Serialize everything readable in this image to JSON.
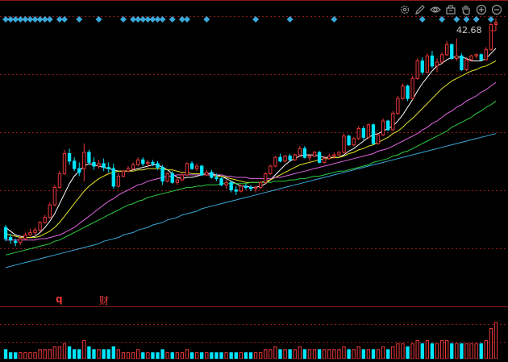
{
  "colors": {
    "background": "#000000",
    "grid": "#8b1a1a",
    "up": "#e8383a",
    "down": "#00e5ff",
    "ma5": "#ffffff",
    "ma10": "#e6e62a",
    "ma20": "#e066e0",
    "ma30": "#2ecc40",
    "ma60": "#3aa7d8",
    "event_diamond": "#3aa7d8",
    "price_label": "#d0d0d0",
    "marker_text": "#e8383a",
    "toolbar_icon": "#9a9a9a"
  },
  "toolbar": {
    "icons": [
      "settings-icon",
      "draw-pen-icon",
      "eye-icon",
      "basket-icon",
      "hand-icon",
      "circle-plus-icon",
      "circle-minus-icon"
    ]
  },
  "price": {
    "last_label": "42.68"
  },
  "markers": {
    "q_label": "q",
    "cai_label": "财"
  },
  "chart_data": {
    "type": "candlestick",
    "title": "",
    "xlabel": "",
    "ylabel": "",
    "ylim": [
      20.0,
      43.5
    ],
    "grid": true,
    "candles": [
      [
        26.3,
        26.5,
        25.2,
        25.4
      ],
      [
        25.5,
        25.8,
        25.0,
        25.3
      ],
      [
        25.2,
        25.4,
        24.8,
        25.1
      ],
      [
        25.1,
        25.6,
        24.9,
        25.4
      ],
      [
        25.4,
        25.9,
        25.3,
        25.7
      ],
      [
        25.7,
        26.2,
        25.6,
        25.9
      ],
      [
        25.9,
        26.3,
        25.7,
        26.1
      ],
      [
        26.1,
        26.8,
        26.0,
        26.7
      ],
      [
        26.7,
        27.3,
        26.6,
        27.1
      ],
      [
        27.1,
        28.3,
        27.0,
        28.1
      ],
      [
        28.1,
        29.7,
        28.0,
        29.5
      ],
      [
        29.5,
        30.8,
        29.4,
        30.6
      ],
      [
        30.6,
        32.5,
        30.5,
        32.2
      ],
      [
        32.2,
        32.6,
        31.3,
        31.6
      ],
      [
        31.6,
        31.9,
        30.8,
        31.0
      ],
      [
        31.0,
        31.5,
        30.4,
        30.7
      ],
      [
        31.0,
        33.0,
        30.0,
        32.3
      ],
      [
        32.3,
        32.5,
        31.3,
        31.5
      ],
      [
        31.5,
        31.9,
        30.9,
        31.2
      ],
      [
        31.2,
        31.7,
        31.0,
        31.4
      ],
      [
        31.4,
        31.8,
        30.8,
        31.1
      ],
      [
        31.1,
        31.5,
        30.7,
        31.0
      ],
      [
        31.0,
        31.4,
        29.4,
        29.6
      ],
      [
        29.6,
        30.7,
        29.5,
        30.4
      ],
      [
        30.4,
        30.9,
        30.3,
        30.8
      ],
      [
        30.8,
        31.2,
        30.7,
        31.0
      ],
      [
        31.0,
        31.5,
        30.9,
        31.3
      ],
      [
        31.3,
        31.9,
        31.2,
        31.7
      ],
      [
        31.7,
        31.9,
        31.2,
        31.4
      ],
      [
        31.4,
        31.7,
        31.1,
        31.5
      ],
      [
        31.5,
        31.7,
        31.2,
        31.4
      ],
      [
        31.4,
        31.6,
        30.9,
        31.1
      ],
      [
        31.1,
        31.3,
        29.7,
        30.0
      ],
      [
        30.0,
        30.7,
        29.9,
        30.6
      ],
      [
        30.6,
        30.8,
        29.8,
        29.9
      ],
      [
        29.9,
        30.3,
        29.7,
        30.1
      ],
      [
        30.1,
        30.7,
        30.0,
        30.5
      ],
      [
        30.5,
        31.5,
        30.4,
        31.4
      ],
      [
        31.4,
        31.6,
        30.9,
        31.0
      ],
      [
        31.0,
        31.4,
        30.8,
        31.2
      ],
      [
        31.2,
        31.3,
        30.4,
        30.5
      ],
      [
        30.5,
        30.9,
        30.4,
        30.7
      ],
      [
        30.7,
        30.9,
        30.2,
        30.3
      ],
      [
        30.3,
        30.6,
        30.0,
        30.2
      ],
      [
        30.2,
        30.3,
        29.6,
        29.7
      ],
      [
        29.7,
        30.1,
        29.4,
        29.9
      ],
      [
        29.9,
        30.0,
        29.1,
        29.3
      ],
      [
        29.3,
        29.6,
        28.9,
        29.2
      ],
      [
        29.2,
        29.7,
        29.1,
        29.6
      ],
      [
        29.6,
        29.8,
        29.3,
        29.5
      ],
      [
        29.5,
        29.7,
        29.2,
        29.4
      ],
      [
        29.4,
        29.6,
        29.1,
        29.5
      ],
      [
        29.5,
        30.0,
        29.4,
        29.9
      ],
      [
        29.9,
        30.7,
        29.8,
        30.6
      ],
      [
        30.6,
        31.3,
        30.5,
        31.2
      ],
      [
        31.2,
        32.0,
        31.1,
        31.9
      ],
      [
        31.9,
        32.2,
        31.5,
        31.6
      ],
      [
        31.6,
        32.1,
        31.5,
        32.0
      ],
      [
        32.0,
        32.2,
        31.6,
        31.7
      ],
      [
        31.7,
        32.2,
        31.6,
        32.1
      ],
      [
        32.1,
        32.8,
        32.0,
        32.6
      ],
      [
        32.6,
        32.8,
        31.8,
        31.9
      ],
      [
        31.9,
        32.2,
        31.6,
        32.0
      ],
      [
        32.0,
        32.4,
        31.9,
        32.3
      ],
      [
        32.3,
        32.4,
        31.4,
        31.5
      ],
      [
        31.5,
        32.0,
        31.4,
        31.8
      ],
      [
        31.8,
        32.2,
        31.7,
        32.0
      ],
      [
        32.0,
        32.3,
        31.8,
        32.1
      ],
      [
        32.1,
        32.4,
        32.0,
        32.3
      ],
      [
        32.3,
        33.8,
        32.2,
        33.6
      ],
      [
        33.6,
        33.7,
        32.8,
        32.9
      ],
      [
        32.9,
        33.5,
        32.8,
        33.4
      ],
      [
        33.4,
        34.4,
        33.3,
        34.2
      ],
      [
        34.2,
        34.4,
        33.3,
        33.5
      ],
      [
        33.5,
        34.6,
        33.4,
        34.5
      ],
      [
        34.5,
        34.6,
        32.9,
        33.0
      ],
      [
        33.0,
        33.8,
        32.9,
        33.7
      ],
      [
        33.7,
        35.0,
        33.6,
        34.8
      ],
      [
        34.8,
        34.9,
        34.0,
        34.1
      ],
      [
        34.1,
        35.6,
        34.0,
        35.4
      ],
      [
        35.4,
        36.8,
        35.3,
        36.6
      ],
      [
        36.6,
        37.8,
        36.5,
        37.6
      ],
      [
        37.6,
        37.7,
        36.4,
        36.6
      ],
      [
        36.6,
        38.4,
        36.5,
        38.2
      ],
      [
        38.2,
        39.8,
        38.1,
        39.6
      ],
      [
        39.6,
        39.9,
        38.5,
        38.7
      ],
      [
        38.7,
        40.2,
        38.6,
        40.0
      ],
      [
        40.0,
        40.4,
        39.0,
        39.2
      ],
      [
        39.2,
        39.8,
        38.7,
        39.5
      ],
      [
        39.5,
        40.3,
        39.4,
        40.1
      ],
      [
        40.1,
        41.2,
        40.0,
        40.9
      ],
      [
        40.9,
        41.0,
        39.7,
        39.8
      ],
      [
        39.8,
        41.4,
        39.6,
        40.0
      ],
      [
        40.0,
        40.2,
        38.8,
        38.9
      ],
      [
        38.9,
        39.9,
        38.8,
        39.7
      ],
      [
        39.7,
        40.1,
        39.6,
        40.0
      ],
      [
        40.0,
        40.2,
        39.8,
        40.1
      ],
      [
        40.1,
        40.2,
        39.6,
        39.7
      ],
      [
        39.7,
        40.7,
        39.6,
        40.5
      ],
      [
        40.5,
        42.6,
        40.4,
        42.5
      ],
      [
        42.5,
        43.0,
        42.1,
        42.68
      ]
    ],
    "ma_lines": [
      {
        "key": "ma5",
        "values": [
          26.3,
          26.0,
          25.7,
          25.6,
          25.5,
          25.5,
          25.6,
          25.9,
          26.3,
          26.8,
          27.4,
          28.2,
          29.0,
          29.8,
          30.4,
          30.8,
          31.2,
          31.4,
          31.3,
          31.2,
          31.1,
          31.0,
          30.9,
          30.8,
          30.8,
          30.8,
          30.9,
          31.0,
          31.1,
          31.2,
          31.3,
          31.3,
          31.1,
          30.9,
          30.6,
          30.3,
          30.2,
          30.3,
          30.3,
          30.4,
          30.5,
          30.6,
          30.6,
          30.5,
          30.4,
          30.2,
          30.0,
          29.8,
          29.6,
          29.6,
          29.5,
          29.5,
          29.6,
          29.8,
          30.1,
          30.5,
          30.9,
          31.3,
          31.6,
          31.8,
          32.0,
          32.1,
          32.1,
          32.1,
          32.0,
          31.9,
          31.9,
          31.9,
          31.9,
          32.1,
          32.4,
          32.6,
          32.9,
          33.2,
          33.5,
          33.7,
          33.8,
          34.0,
          34.2,
          34.4,
          34.8,
          35.3,
          35.9,
          36.5,
          37.2,
          37.8,
          38.3,
          38.8,
          39.2,
          39.4,
          39.7,
          39.9,
          39.9,
          39.9,
          39.8,
          39.6,
          39.6,
          39.6,
          39.8,
          40.2,
          40.6
        ]
      },
      {
        "key": "ma10",
        "values": [
          25.8,
          25.7,
          25.6,
          25.5,
          25.5,
          25.5,
          25.5,
          25.6,
          25.8,
          26.0,
          26.3,
          26.7,
          27.2,
          27.7,
          28.2,
          28.7,
          29.2,
          29.6,
          29.9,
          30.2,
          30.4,
          30.6,
          30.7,
          30.8,
          30.8,
          30.8,
          30.8,
          30.9,
          30.9,
          31.0,
          31.0,
          31.0,
          31.0,
          30.9,
          30.9,
          30.8,
          30.7,
          30.7,
          30.6,
          30.6,
          30.6,
          30.5,
          30.5,
          30.4,
          30.4,
          30.3,
          30.2,
          30.1,
          30.0,
          29.9,
          29.9,
          29.9,
          29.9,
          30.0,
          30.1,
          30.3,
          30.5,
          30.7,
          30.9,
          31.1,
          31.3,
          31.4,
          31.5,
          31.6,
          31.7,
          31.8,
          31.8,
          31.9,
          31.9,
          32.0,
          32.2,
          32.3,
          32.5,
          32.6,
          32.8,
          32.9,
          33.1,
          33.3,
          33.5,
          33.8,
          34.0,
          34.3,
          34.7,
          35.0,
          35.4,
          35.8,
          36.2,
          36.6,
          37.0,
          37.4,
          37.7,
          38.0,
          38.2,
          38.4,
          38.6,
          38.8,
          38.9,
          39.1,
          39.2,
          39.4,
          39.6
        ]
      },
      {
        "key": "ma20",
        "values": [
          25.3,
          25.3,
          25.3,
          25.3,
          25.3,
          25.3,
          25.3,
          25.4,
          25.4,
          25.5,
          25.6,
          25.7,
          25.9,
          26.1,
          26.3,
          26.6,
          26.9,
          27.2,
          27.5,
          27.8,
          28.1,
          28.4,
          28.6,
          28.9,
          29.1,
          29.3,
          29.5,
          29.7,
          29.8,
          30.0,
          30.1,
          30.2,
          30.3,
          30.4,
          30.4,
          30.5,
          30.5,
          30.5,
          30.5,
          30.5,
          30.5,
          30.5,
          30.5,
          30.5,
          30.5,
          30.4,
          30.4,
          30.3,
          30.3,
          30.3,
          30.2,
          30.2,
          30.2,
          30.2,
          30.2,
          30.3,
          30.3,
          30.4,
          30.5,
          30.6,
          30.7,
          30.8,
          30.9,
          31.0,
          31.1,
          31.2,
          31.3,
          31.4,
          31.5,
          31.6,
          31.7,
          31.8,
          31.9,
          32.0,
          32.1,
          32.2,
          32.4,
          32.5,
          32.6,
          32.8,
          33.0,
          33.2,
          33.4,
          33.6,
          33.8,
          34.1,
          34.3,
          34.6,
          34.8,
          35.1,
          35.4,
          35.6,
          35.9,
          36.1,
          36.4,
          36.6,
          36.8,
          37.1,
          37.3,
          37.6,
          37.9
        ]
      },
      {
        "key": "ma30",
        "values": [
          24.1,
          24.2,
          24.3,
          24.4,
          24.5,
          24.6,
          24.7,
          24.8,
          24.9,
          25.0,
          25.2,
          25.3,
          25.5,
          25.7,
          25.9,
          26.1,
          26.3,
          26.5,
          26.7,
          26.9,
          27.1,
          27.3,
          27.5,
          27.7,
          27.9,
          28.1,
          28.2,
          28.4,
          28.5,
          28.7,
          28.8,
          28.9,
          29.0,
          29.1,
          29.2,
          29.3,
          29.4,
          29.5,
          29.5,
          29.6,
          29.6,
          29.7,
          29.7,
          29.7,
          29.8,
          29.8,
          29.8,
          29.8,
          29.8,
          29.8,
          29.9,
          29.9,
          29.9,
          29.9,
          29.9,
          30.0,
          30.0,
          30.0,
          30.1,
          30.1,
          30.2,
          30.2,
          30.3,
          30.4,
          30.4,
          30.5,
          30.6,
          30.7,
          30.8,
          30.8,
          30.9,
          31.0,
          31.1,
          31.2,
          31.3,
          31.5,
          31.6,
          31.7,
          31.8,
          32.0,
          32.1,
          32.3,
          32.4,
          32.6,
          32.8,
          33.0,
          33.2,
          33.4,
          33.6,
          33.8,
          34.0,
          34.3,
          34.5,
          34.7,
          34.9,
          35.1,
          35.4,
          35.6,
          35.9,
          36.1,
          36.4
        ]
      },
      {
        "key": "ma60",
        "values": [
          23.1,
          23.2,
          23.3,
          23.4,
          23.5,
          23.6,
          23.7,
          23.8,
          23.9,
          24.0,
          24.1,
          24.2,
          24.3,
          24.4,
          24.5,
          24.6,
          24.7,
          24.8,
          24.9,
          25.0,
          25.2,
          25.3,
          25.4,
          25.5,
          25.7,
          25.8,
          25.9,
          26.1,
          26.2,
          26.3,
          26.5,
          26.6,
          26.7,
          26.9,
          27.0,
          27.1,
          27.3,
          27.4,
          27.5,
          27.6,
          27.8,
          27.9,
          28.0,
          28.1,
          28.2,
          28.3,
          28.4,
          28.5,
          28.6,
          28.7,
          28.8,
          28.9,
          29.0,
          29.1,
          29.2,
          29.3,
          29.4,
          29.5,
          29.6,
          29.7,
          29.8,
          29.9,
          30.0,
          30.1,
          30.2,
          30.3,
          30.4,
          30.5,
          30.6,
          30.7,
          30.8,
          30.9,
          31.0,
          31.1,
          31.2,
          31.3,
          31.4,
          31.5,
          31.6,
          31.7,
          31.8,
          31.9,
          32.0,
          32.1,
          32.2,
          32.3,
          32.4,
          32.5,
          32.6,
          32.7,
          32.8,
          32.9,
          33.0,
          33.1,
          33.2,
          33.3,
          33.4,
          33.5,
          33.6,
          33.7,
          33.8
        ]
      }
    ],
    "volume": [
      3,
      2,
      2,
      2,
      2,
      2,
      2,
      3,
      3,
      3,
      4,
      4,
      5,
      4,
      3,
      3,
      6,
      4,
      3,
      3,
      3,
      3,
      4,
      3,
      2,
      2,
      2,
      3,
      2,
      2,
      2,
      2,
      3,
      2,
      2,
      2,
      2,
      3,
      2,
      2,
      2,
      2,
      2,
      2,
      2,
      2,
      2,
      2,
      2,
      2,
      2,
      2,
      2,
      3,
      3,
      4,
      3,
      3,
      3,
      3,
      4,
      3,
      3,
      3,
      3,
      3,
      3,
      3,
      3,
      4,
      3,
      3,
      4,
      3,
      3,
      3,
      3,
      4,
      3,
      4,
      5,
      5,
      4,
      5,
      6,
      5,
      6,
      5,
      5,
      6,
      6,
      5,
      5,
      5,
      5,
      5,
      5,
      5,
      6,
      10,
      12
    ],
    "event_diamond_indices": [
      0,
      1,
      2,
      3,
      4,
      5,
      6,
      7,
      8,
      9,
      11,
      12,
      15,
      19,
      24,
      26,
      27,
      28,
      29,
      30,
      31,
      32,
      34,
      36,
      37,
      41,
      51,
      58,
      67,
      85,
      89,
      92,
      94,
      96,
      99
    ]
  }
}
